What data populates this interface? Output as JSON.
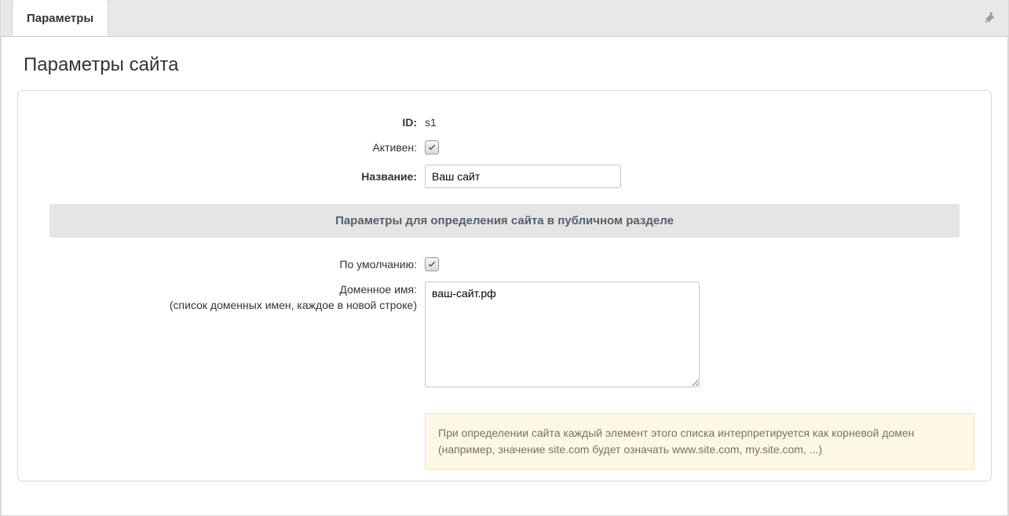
{
  "tab": {
    "label": "Параметры"
  },
  "page_title": "Параметры сайта",
  "fields": {
    "id": {
      "label": "ID:",
      "value": "s1"
    },
    "active": {
      "label": "Активен:",
      "checked": true
    },
    "name": {
      "label": "Название:",
      "value": "Ваш сайт"
    },
    "default": {
      "label": "По умолчанию:",
      "checked": true
    },
    "domain": {
      "label": "Доменное имя:",
      "sublabel": "(список доменных имен, каждое в новой строке)",
      "value": "ваш-сайт.рф"
    }
  },
  "section_heading": "Параметры для определения сайта в публичном разделе",
  "hint": "При определении сайта каждый элемент этого списка интерпретируется как корневой домен (например, значение site.com будет означать www.site.com, my.site.com, ...)"
}
